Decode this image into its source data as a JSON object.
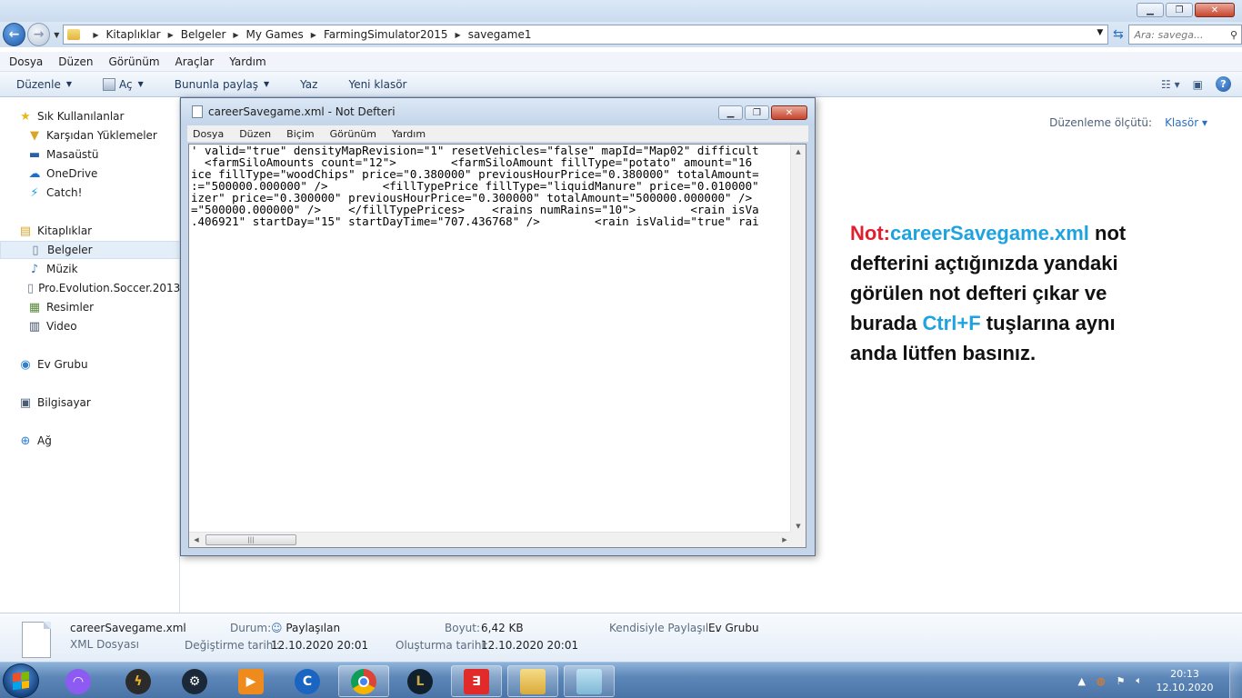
{
  "address": {
    "crumbs": [
      "Kitaplıklar",
      "Belgeler",
      "My Games",
      "FarmingSimulator2015",
      "savegame1"
    ],
    "search_placeholder": "Ara: savega..."
  },
  "menubar": [
    "Dosya",
    "Düzen",
    "Görünüm",
    "Araçlar",
    "Yardım"
  ],
  "commands": {
    "organize": "Düzenle",
    "open": "Aç",
    "share": "Bununla paylaş",
    "print": "Yaz",
    "new_folder": "Yeni klasör"
  },
  "sidebar": {
    "favorites": "Sık Kullanılanlar",
    "downloads": "Karşıdan Yüklemeler",
    "desktop": "Masaüstü",
    "onedrive": "OneDrive",
    "catch": "Catch!",
    "libraries": "Kitaplıklar",
    "documents": "Belgeler",
    "music": "Müzik",
    "pes": "Pro.Evolution.Soccer.2013",
    "pictures": "Resimler",
    "video": "Video",
    "homegroup": "Ev Grubu",
    "computer": "Bilgisayar",
    "network": "Ağ"
  },
  "arrange": {
    "label": "Düzenleme ölçütü:",
    "value": "Klasör"
  },
  "note": {
    "prefix": "Not:",
    "filename": "careerSavegame.xml",
    "part1": " not defterini açtığınızda yandaki görülen not defteri çıkar ve burada ",
    "hotkey": "Ctrl+F",
    "part2": " tuşlarına aynı anda lütfen basınız."
  },
  "notepad": {
    "title": "careerSavegame.xml - Not Defteri",
    "menu": [
      "Dosya",
      "Düzen",
      "Biçim",
      "Görünüm",
      "Yardım"
    ],
    "lines": [
      "' valid=\"true\" densityMapRevision=\"1\" resetVehicles=\"false\" mapId=\"Map02\" difficult",
      "  <farmSiloAmounts count=\"12\">        <farmSiloAmount fillType=\"potato\" amount=\"16",
      "ice fillType=\"woodChips\" price=\"0.380000\" previousHourPrice=\"0.380000\" totalAmount=",
      ":=\"500000.000000\" />        <fillTypePrice fillType=\"liquidManure\" price=\"0.010000\"",
      "izer\" price=\"0.300000\" previousHourPrice=\"0.300000\" totalAmount=\"500000.000000\" />",
      "=\"500000.000000\" />    </fillTypePrices>    <rains numRains=\"10\">        <rain isVa",
      ".406921\" startDay=\"15\" startDayTime=\"707.436768\" />        <rain isValid=\"true\" rai"
    ]
  },
  "details": {
    "filename": "careerSavegame.xml",
    "filetype": "XML Dosyası",
    "status_label": "Durum:",
    "status_value": "Paylaşılan",
    "modified_label": "Değiştirme tarihi:",
    "modified_value": "12.10.2020 20:01",
    "size_label": "Boyut:",
    "size_value": "6,42 KB",
    "created_label": "Oluşturma tarihi:",
    "created_value": "12.10.2020 20:01",
    "shared_label": "Kendisiyle Paylaşıl...",
    "shared_value": "Ev Grubu"
  },
  "tray": {
    "time": "20:13",
    "date": "12.10.2020"
  },
  "colors": {
    "note_red": "#e31e2f",
    "note_blue": "#1fa3e0",
    "taskbar": "#5d87b8"
  }
}
